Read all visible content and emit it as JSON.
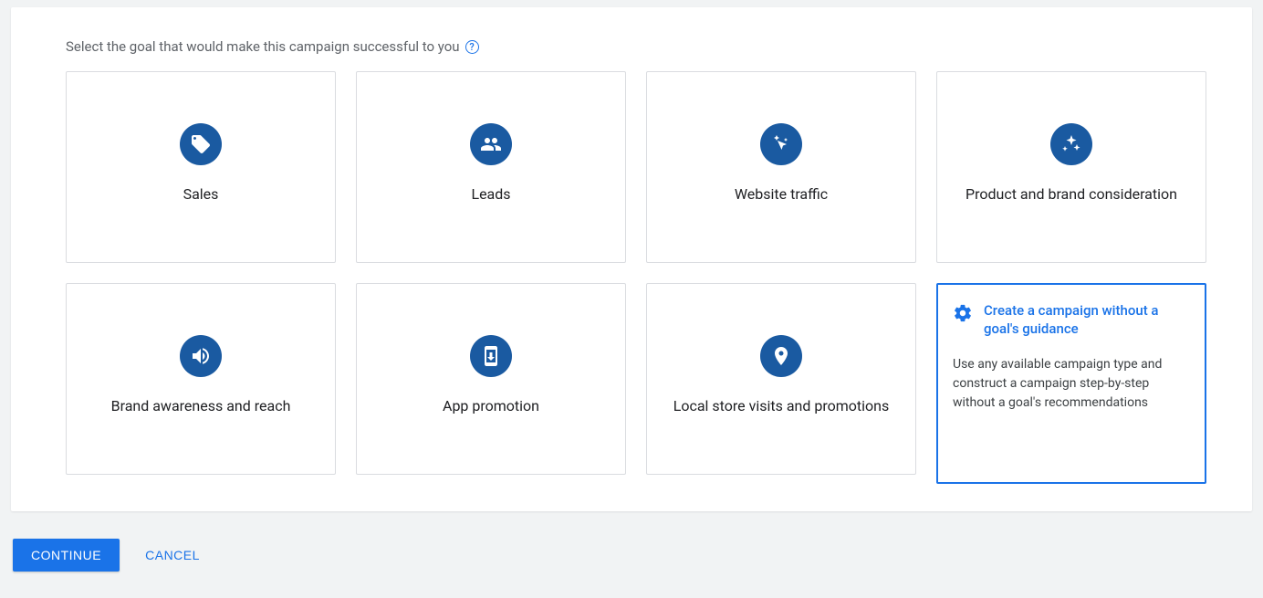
{
  "heading": "Select the goal that would make this campaign successful to you",
  "help_tooltip": "?",
  "goals": [
    {
      "id": "sales",
      "label": "Sales",
      "icon": "tag"
    },
    {
      "id": "leads",
      "label": "Leads",
      "icon": "people"
    },
    {
      "id": "website-traffic",
      "label": "Website traffic",
      "icon": "cursor-sparkle"
    },
    {
      "id": "product-brand",
      "label": "Product and brand consideration",
      "icon": "sparkles"
    },
    {
      "id": "brand-awareness",
      "label": "Brand awareness and reach",
      "icon": "megaphone"
    },
    {
      "id": "app-promotion",
      "label": "App promotion",
      "icon": "phone-download"
    },
    {
      "id": "local-store",
      "label": "Local store visits and promotions",
      "icon": "pin"
    }
  ],
  "no_goal": {
    "title": "Create a campaign without a goal's guidance",
    "description": "Use any available campaign type and construct a campaign step-by-step without a goal's recommendations"
  },
  "actions": {
    "continue": "CONTINUE",
    "cancel": "CANCEL"
  }
}
